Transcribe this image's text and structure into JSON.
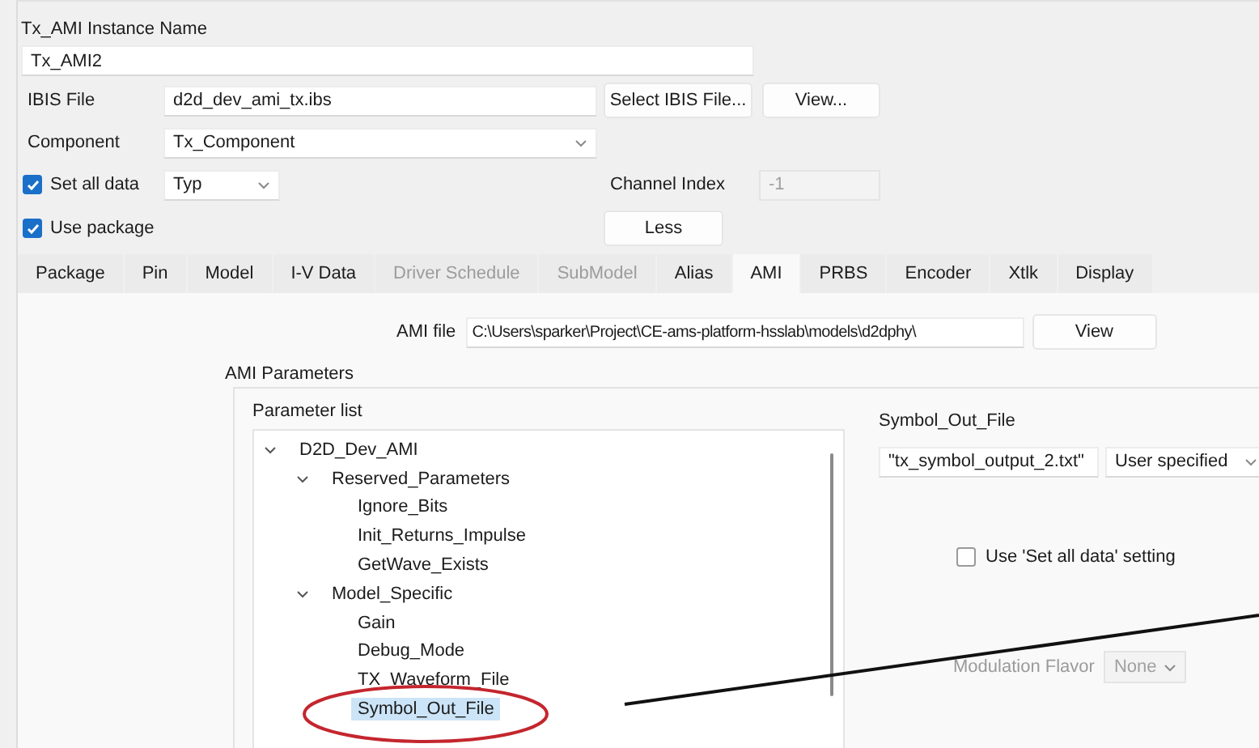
{
  "instance_name": {
    "label": "Tx_AMI Instance Name",
    "value": "Tx_AMI2"
  },
  "ibis_file": {
    "label": "IBIS File",
    "value": "d2d_dev_ami_tx.ibs",
    "select_button": "Select IBIS File...",
    "view_button": "View..."
  },
  "component": {
    "label": "Component",
    "value": "Tx_Component"
  },
  "set_all_data": {
    "label": "Set all data",
    "checked": true,
    "value": "Typ"
  },
  "channel_index": {
    "label": "Channel Index",
    "value": "-1",
    "disabled": true
  },
  "use_package": {
    "label": "Use package",
    "checked": true
  },
  "less_button": "Less",
  "tabs": [
    {
      "label": "Package",
      "selected": false,
      "disabled": false
    },
    {
      "label": "Pin",
      "selected": false,
      "disabled": false
    },
    {
      "label": "Model",
      "selected": false,
      "disabled": false
    },
    {
      "label": "I-V Data",
      "selected": false,
      "disabled": false
    },
    {
      "label": "Driver Schedule",
      "selected": false,
      "disabled": true
    },
    {
      "label": "SubModel",
      "selected": false,
      "disabled": true
    },
    {
      "label": "Alias",
      "selected": false,
      "disabled": false
    },
    {
      "label": "AMI",
      "selected": true,
      "disabled": false
    },
    {
      "label": "PRBS",
      "selected": false,
      "disabled": false
    },
    {
      "label": "Encoder",
      "selected": false,
      "disabled": false
    },
    {
      "label": "Xtlk",
      "selected": false,
      "disabled": false
    },
    {
      "label": "Display",
      "selected": false,
      "disabled": false
    }
  ],
  "ami_file": {
    "label": "AMI file",
    "value": "C:\\Users\\sparker\\Project\\CE-ams-platform-hsslab\\models\\d2dphy\\",
    "button": "View"
  },
  "ami_parameters": {
    "title": "AMI Parameters",
    "list_label": "Parameter list",
    "tree": [
      {
        "label": "D2D_Dev_AMI",
        "expanded": true,
        "selected": false,
        "children": [
          {
            "label": "Reserved_Parameters",
            "expanded": true,
            "selected": false,
            "children": [
              {
                "label": "Ignore_Bits",
                "selected": false
              },
              {
                "label": "Init_Returns_Impulse",
                "selected": false
              },
              {
                "label": "GetWave_Exists",
                "selected": false
              }
            ]
          },
          {
            "label": "Model_Specific",
            "expanded": true,
            "selected": false,
            "children": [
              {
                "label": "Gain",
                "selected": false
              },
              {
                "label": "Debug_Mode",
                "selected": false
              },
              {
                "label": "TX_Waveform_File",
                "selected": false
              },
              {
                "label": "Symbol_Out_File",
                "selected": true
              }
            ]
          }
        ]
      }
    ]
  },
  "parameter_detail": {
    "title": "Symbol_Out_File",
    "value": "\"tx_symbol_output_2.txt\"",
    "mode": "User specified",
    "use_set_all": {
      "label": "Use 'Set all data' setting",
      "checked": false
    },
    "modulation_flavor": {
      "label": "Modulation Flavor",
      "value": "None",
      "disabled": true
    }
  },
  "annotations": [
    {
      "kind": "ellipse",
      "color": "#c4262e"
    },
    {
      "kind": "line",
      "color": "#111111"
    }
  ]
}
